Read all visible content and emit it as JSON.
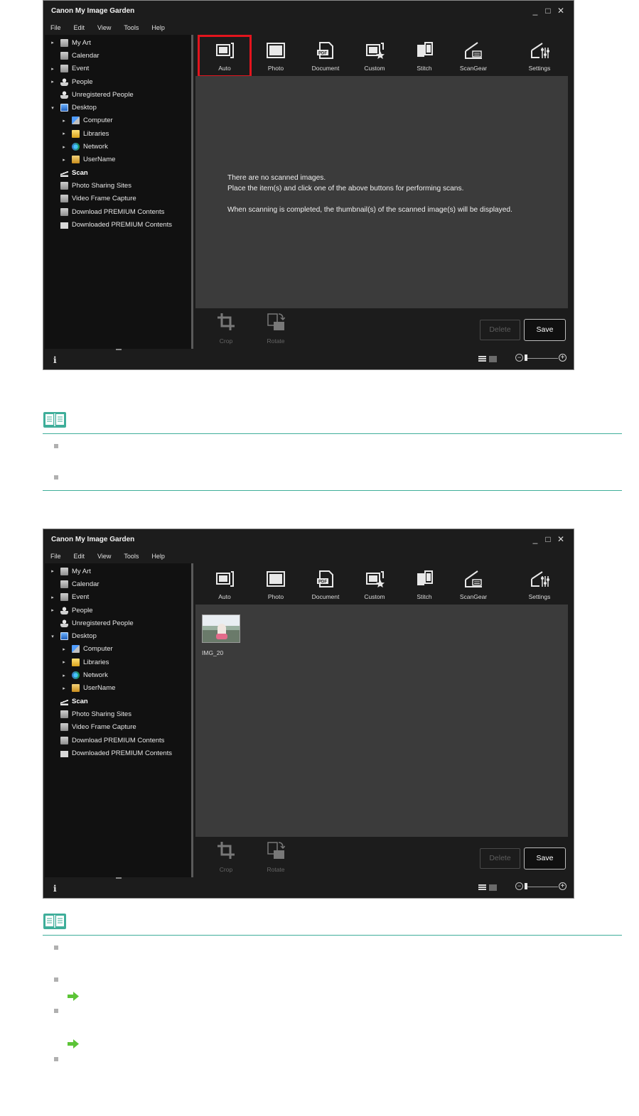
{
  "app": {
    "title": "Canon My Image Garden",
    "window_controls": [
      "_",
      "□",
      "✕"
    ],
    "menu": [
      "File",
      "Edit",
      "View",
      "Tools",
      "Help"
    ]
  },
  "tree": [
    {
      "label": "My Art",
      "expand": "▸",
      "icon": "my-art-icon"
    },
    {
      "label": "Calendar",
      "expand": "",
      "icon": "calendar-icon"
    },
    {
      "label": "Event",
      "expand": "▸",
      "icon": "event-icon"
    },
    {
      "label": "People",
      "expand": "▸",
      "icon": "people-icon"
    },
    {
      "label": "Unregistered People",
      "expand": "",
      "icon": "unregistered-people-icon"
    },
    {
      "label": "Desktop",
      "expand": "▾",
      "icon": "desktop-icon"
    },
    {
      "label": "Computer",
      "expand": "▸",
      "icon": "computer-icon",
      "level": 2
    },
    {
      "label": "Libraries",
      "expand": "▸",
      "icon": "libraries-icon",
      "level": 2
    },
    {
      "label": "Network",
      "expand": "▸",
      "icon": "network-icon",
      "level": 2
    },
    {
      "label": "UserName",
      "expand": "▸",
      "icon": "user-folder-icon",
      "level": 2
    },
    {
      "label": "Scan",
      "expand": "",
      "icon": "scan-icon",
      "selected": true
    },
    {
      "label": "Photo Sharing Sites",
      "expand": "",
      "icon": "photo-sharing-icon"
    },
    {
      "label": "Video Frame Capture",
      "expand": "",
      "icon": "video-frame-icon"
    },
    {
      "label": "Download PREMIUM Contents",
      "expand": "",
      "icon": "download-premium-icon"
    },
    {
      "label": "Downloaded PREMIUM Contents",
      "expand": "",
      "icon": "folder-icon"
    }
  ],
  "toolbar": {
    "auto": "Auto",
    "photo": "Photo",
    "document": "Document",
    "custom": "Custom",
    "stitch": "Stitch",
    "scangear": "ScanGear",
    "settings": "Settings",
    "pdf_badge": "PDF"
  },
  "empty_message": {
    "line1": "There are no scanned images.",
    "line2": "Place the item(s) and click one of the above buttons for performing scans.",
    "line3": "When scanning is completed, the thumbnail(s) of the scanned image(s) will be displayed."
  },
  "thumbnail": {
    "name": "IMG_20"
  },
  "bottom_tools": {
    "crop": "Crop",
    "rotate": "Rotate",
    "delete": "Delete",
    "save": "Save"
  },
  "statusbar": {
    "info": "i",
    "zoom_minus": "−",
    "zoom_plus": "+"
  },
  "colors": {
    "highlight": "#e3141d",
    "note_rule": "#3fae9a",
    "link_arrow": "#5cc437"
  }
}
